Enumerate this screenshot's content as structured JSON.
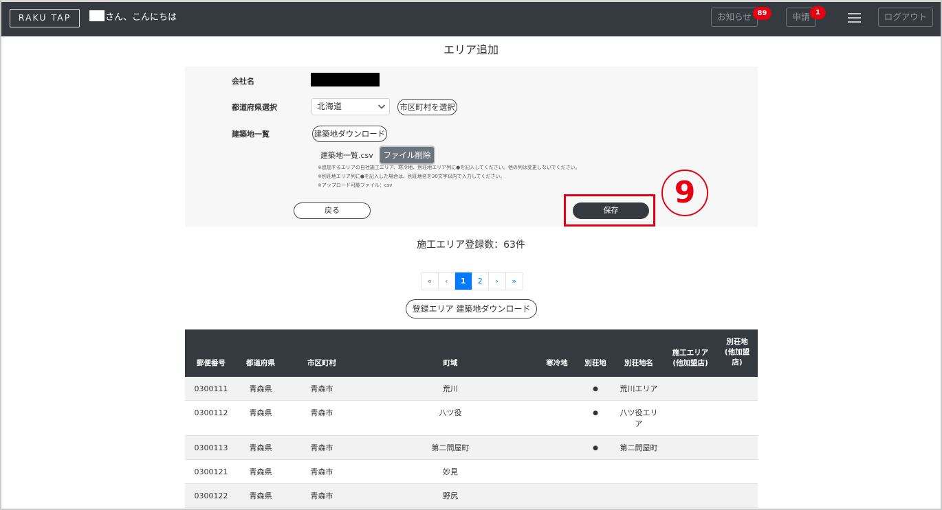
{
  "header": {
    "logo": "RAKU TAP",
    "greeting": "さん、こんにちは",
    "notice_label": "お知らせ",
    "notice_count": "89",
    "apply_label": "申請",
    "apply_count": "1",
    "logout_label": "ログアウト"
  },
  "page": {
    "title": "エリア追加"
  },
  "form": {
    "company_label": "会社名",
    "prefecture_label": "都道府県選択",
    "prefecture_value": "北海道",
    "city_button": "市区町村を選択",
    "site_list_label": "建築地一覧",
    "site_download_button": "建築地ダウンロード",
    "file_name": "建築地一覧.csv",
    "file_delete_button": "ファイル削除",
    "notes": [
      "※追加するエリアの自社施工エリア、寒冷地、別荘地エリア列に●を記入してください。他の列は変更しないでください。",
      "※別荘地エリア列に●を記入した場合は、別荘地名を30文字以内で入力してください。",
      "※アップロード可能ファイル：csv"
    ],
    "back_button": "戻る",
    "save_button": "保存",
    "step_marker": "9"
  },
  "summary": {
    "count_text": "施工エリア登録数：63件"
  },
  "pagination": {
    "first": "«",
    "prev": "‹",
    "pages": [
      "1",
      "2"
    ],
    "next": "›",
    "last": "»"
  },
  "area_download_button": "登録エリア 建築地ダウンロード",
  "table": {
    "columns": [
      [
        "郵便番号"
      ],
      [
        "都道府県"
      ],
      [
        "市区町村"
      ],
      [
        "町域"
      ],
      [
        "寒冷地"
      ],
      [
        "別荘地"
      ],
      [
        "別荘地名"
      ],
      [
        "施工エリア",
        "(他加盟店)"
      ],
      [
        "別荘地",
        "(他加盟",
        "店)"
      ]
    ],
    "rows": [
      {
        "zip": "0300111",
        "pref": "青森県",
        "city": "青森市",
        "town": "荒川",
        "cold": "",
        "villa": "●",
        "villa_name": [
          "荒川エリア"
        ],
        "other_area": "",
        "other_villa": ""
      },
      {
        "zip": "0300112",
        "pref": "青森県",
        "city": "青森市",
        "town": "八ツ役",
        "cold": "",
        "villa": "●",
        "villa_name": [
          "八ツ役エリ",
          "ア"
        ],
        "other_area": "",
        "other_villa": ""
      },
      {
        "zip": "0300113",
        "pref": "青森県",
        "city": "青森市",
        "town": "第二問屋町",
        "cold": "",
        "villa": "●",
        "villa_name": [
          "第二問屋町"
        ],
        "other_area": "",
        "other_villa": ""
      },
      {
        "zip": "0300121",
        "pref": "青森県",
        "city": "青森市",
        "town": "妙見",
        "cold": "",
        "villa": "",
        "villa_name": [
          ""
        ],
        "other_area": "",
        "other_villa": ""
      },
      {
        "zip": "0300122",
        "pref": "青森県",
        "city": "青森市",
        "town": "野尻",
        "cold": "",
        "villa": "",
        "villa_name": [
          ""
        ],
        "other_area": "",
        "other_villa": ""
      }
    ]
  }
}
